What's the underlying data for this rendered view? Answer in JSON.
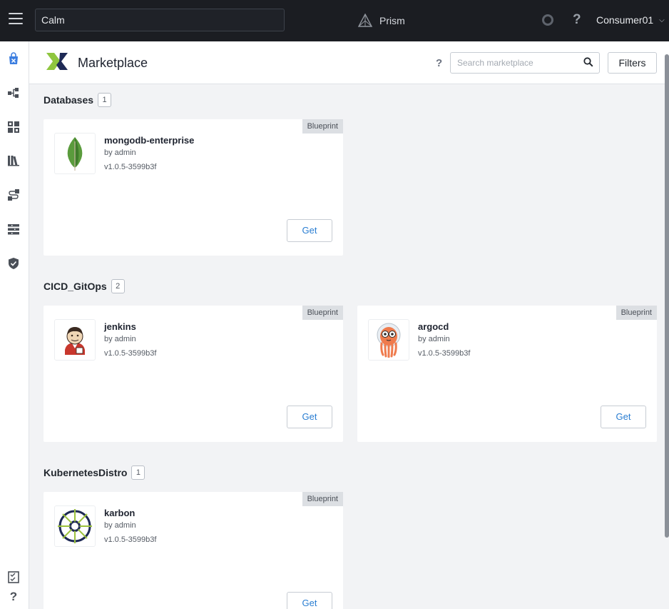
{
  "topbar": {
    "app_search_value": "Calm",
    "brand": "Prism",
    "user": "Consumer01"
  },
  "header": {
    "title": "Marketplace",
    "help": "?",
    "search_placeholder": "Search marketplace",
    "filters_label": "Filters"
  },
  "nav_icons": [
    "marketplace-icon",
    "blueprints-icon",
    "applications-icon",
    "library-icon",
    "runbooks-icon",
    "environments-icon",
    "policies-icon",
    "tasks-icon",
    "help-icon"
  ],
  "sections": [
    {
      "title": "Databases",
      "count": "1",
      "items": [
        {
          "name": "mongodb-enterprise",
          "by": "by admin",
          "version": "v1.0.5-3599b3f",
          "tag": "Blueprint",
          "action": "Get",
          "icon": "mongodb-leaf-icon"
        }
      ]
    },
    {
      "title": "CICD_GitOps",
      "count": "2",
      "items": [
        {
          "name": "jenkins",
          "by": "by admin",
          "version": "v1.0.5-3599b3f",
          "tag": "Blueprint",
          "action": "Get",
          "icon": "jenkins-icon"
        },
        {
          "name": "argocd",
          "by": "by admin",
          "version": "v1.0.5-3599b3f",
          "tag": "Blueprint",
          "action": "Get",
          "icon": "argocd-icon"
        }
      ]
    },
    {
      "title": "KubernetesDistro",
      "count": "1",
      "items": [
        {
          "name": "karbon",
          "by": "by admin",
          "version": "v1.0.5-3599b3f",
          "tag": "Blueprint",
          "action": "Get",
          "icon": "karbon-wheel-icon"
        }
      ]
    }
  ],
  "colors": {
    "topbar": "#1b1d22",
    "accent": "#2a7ed2",
    "nav_active": "#3c7ee0"
  }
}
